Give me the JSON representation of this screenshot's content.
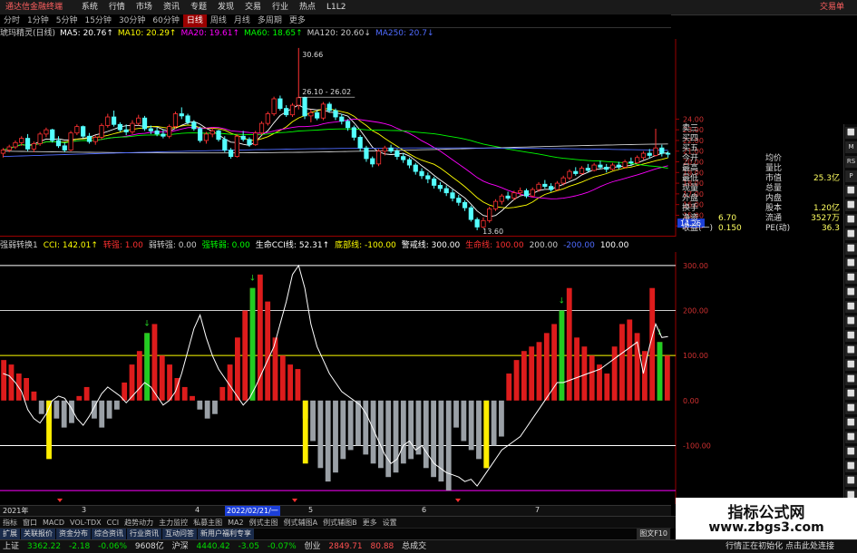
{
  "app": {
    "title": "通达信金融终端",
    "right_label": "交易单"
  },
  "menubar": {
    "items": [
      "系统",
      "行情",
      "市场",
      "资讯",
      "专题",
      "发现",
      "交易",
      "行业",
      "热点",
      "L1L2"
    ]
  },
  "periods": {
    "items": [
      "分时",
      "1分钟",
      "5分钟",
      "15分钟",
      "30分钟",
      "60分钟",
      "日线",
      "周线",
      "月线",
      "多周期",
      "更多"
    ],
    "active": "日线"
  },
  "ma_legend": [
    {
      "label": "琥玛精灵(日线)",
      "color": "#cccccc"
    },
    {
      "label": "MA5: 20.76↑",
      "color": "#ffffff"
    },
    {
      "label": "MA10: 20.29↑",
      "color": "#ffff00"
    },
    {
      "label": "MA20: 19.61↑",
      "color": "#ff00ff"
    },
    {
      "label": "MA60: 18.65↑",
      "color": "#00ff00"
    },
    {
      "label": "MA120: 20.60↓",
      "color": "#cccccc"
    },
    {
      "label": "MA250: 20.7↓",
      "color": "#4f6bff"
    }
  ],
  "indicator_legend": [
    {
      "label": "强弱转换1",
      "color": "#cccccc"
    },
    {
      "label": "CCI: 142.01↑",
      "color": "#ffff00"
    },
    {
      "label": "转强: 1.00",
      "color": "#ff3030"
    },
    {
      "label": "弱转强: 0.00",
      "color": "#cccccc"
    },
    {
      "label": "强转弱: 0.00",
      "color": "#00ff00"
    },
    {
      "label": "生命CCI线: 52.31↑",
      "color": "#ffffff"
    },
    {
      "label": "底部线: -100.00",
      "color": "#ffff00"
    },
    {
      "label": "警戒线: 300.00",
      "color": "#ffffff"
    },
    {
      "label": "生命线: 100.00",
      "color": "#ff3030"
    },
    {
      "label": "200.00",
      "color": "#cccccc"
    },
    {
      "label": "-200.00",
      "color": "#4f6bff"
    },
    {
      "label": "100.00",
      "color": "#ffffff"
    }
  ],
  "quote_panel": {
    "rows": [
      {
        "left": "卖三",
        "mid": "",
        "right": ""
      },
      {
        "left": "买四",
        "mid": "",
        "right": ""
      },
      {
        "left": "买五",
        "mid": "",
        "right": ""
      },
      {
        "left": "今开",
        "mid": "均价",
        "right": ""
      },
      {
        "left": "最高",
        "mid": "量比",
        "right": ""
      },
      {
        "left": "最低",
        "mid": "市值",
        "right": "25.3亿"
      },
      {
        "left": "现量",
        "mid": "总量",
        "right": ""
      },
      {
        "left": "外盘",
        "mid": "内盘",
        "right": ""
      },
      {
        "left": "换手",
        "mid": "股本",
        "right": "1.20亿"
      },
      {
        "left": "净资",
        "mid": "6.70",
        "right": "3527万",
        "midlabel": "流通"
      },
      {
        "left": "收益(一)",
        "mid": "0.150",
        "right": "36.3",
        "midlabel": "PE(动)"
      }
    ]
  },
  "right_toolbar": {
    "items": [
      "⬜",
      "M",
      "RS",
      "P",
      "⬜",
      "⬜",
      "⬜",
      "⬜",
      "⬜",
      "⬜",
      "⬜",
      "⬜",
      "⬜",
      "⬜",
      "⬜",
      "⬜",
      "⬜",
      "⬜",
      "⬜",
      "⬜",
      "⬜",
      "⬜",
      "⬜",
      "⬜",
      "⬜",
      "⬜",
      "⬜"
    ]
  },
  "date_bar": {
    "start": "2021年",
    "cursor": "2022/02/21/一",
    "marks": [
      "3",
      "4",
      "5",
      "6",
      "7"
    ]
  },
  "tabs": {
    "items": [
      "指标",
      "窗口",
      "MACD",
      "VOL-TDX",
      "CCI",
      "趋势动力",
      "主力监控",
      "私募主图",
      "MA2",
      "例式主图",
      "例式辅图A",
      "例式辅图B",
      "更多",
      "设置"
    ],
    "right": "模板"
  },
  "tabs2": {
    "items": [
      "扩展",
      "关联报价",
      "资金分布",
      "综合资讯",
      "行业资讯",
      "互动问答",
      "新用户福利专享"
    ],
    "right": "图文F10"
  },
  "status": {
    "sh_label": "上证",
    "sh_value": "3362.22",
    "sh_change": "-2.18",
    "sh_pct": "-0.06%",
    "sh_amount": "9608亿",
    "sz_label": "沪深",
    "sz_value": "4440.42",
    "sz_change": "-3.05",
    "sz_pct": "-0.07%",
    "cy_label": "创业",
    "cy_value": "2849.71",
    "cy_change": "80.88",
    "other": "总成交",
    "msg": "行情正在初始化 点击此处连接"
  },
  "watermark": {
    "title": "指标公式网",
    "url": "www.zbgs3.com"
  },
  "chart_data": [
    {
      "type": "candlestick",
      "title": "",
      "xlabel": "",
      "ylabel": "",
      "y_ticks": [
        14.0,
        15.0,
        16.0,
        17.0,
        18.0,
        19.0,
        20.0,
        21.0,
        22.0,
        23.0,
        24.0
      ],
      "ylim": [
        13.0,
        31.5
      ],
      "current_price_label": "14.26",
      "annotations": [
        {
          "text": "30.66",
          "kind": "high"
        },
        {
          "text": "26.10 - 26.02",
          "kind": "range"
        },
        {
          "text": "13.60",
          "kind": "low"
        }
      ],
      "grid": false,
      "candles": [
        [
          20.8,
          21.3,
          20.4,
          21.1
        ],
        [
          21.1,
          21.6,
          20.9,
          21.4
        ],
        [
          21.4,
          22.0,
          21.2,
          21.8
        ],
        [
          21.8,
          22.4,
          21.5,
          22.2
        ],
        [
          22.2,
          22.6,
          21.0,
          21.2
        ],
        [
          21.2,
          21.9,
          20.9,
          21.7
        ],
        [
          21.7,
          22.8,
          21.5,
          22.6
        ],
        [
          22.6,
          23.2,
          22.3,
          23.0
        ],
        [
          23.0,
          23.1,
          21.8,
          22.0
        ],
        [
          22.0,
          22.4,
          21.3,
          21.5
        ],
        [
          21.5,
          21.8,
          20.9,
          21.1
        ],
        [
          21.1,
          22.9,
          21.0,
          22.7
        ],
        [
          22.7,
          23.5,
          22.5,
          23.3
        ],
        [
          23.3,
          23.4,
          22.2,
          22.4
        ],
        [
          22.4,
          22.7,
          21.7,
          21.9
        ],
        [
          21.9,
          22.5,
          21.6,
          22.3
        ],
        [
          22.3,
          23.6,
          22.1,
          23.4
        ],
        [
          23.4,
          24.5,
          23.2,
          24.2
        ],
        [
          24.2,
          24.8,
          23.3,
          23.5
        ],
        [
          23.5,
          23.7,
          22.8,
          23.0
        ],
        [
          23.0,
          23.5,
          22.5,
          22.8
        ],
        [
          22.8,
          23.9,
          22.6,
          23.6
        ],
        [
          23.6,
          24.4,
          23.4,
          24.1
        ],
        [
          24.1,
          24.3,
          22.9,
          23.1
        ],
        [
          23.1,
          23.4,
          22.6,
          22.9
        ],
        [
          22.9,
          23.2,
          22.4,
          22.6
        ],
        [
          22.6,
          23.0,
          22.2,
          22.4
        ],
        [
          22.4,
          23.5,
          22.2,
          23.3
        ],
        [
          23.3,
          24.7,
          23.1,
          24.5
        ],
        [
          24.5,
          25.1,
          24.0,
          24.3
        ],
        [
          24.3,
          24.5,
          23.5,
          23.7
        ],
        [
          23.7,
          23.9,
          22.9,
          23.1
        ],
        [
          23.1,
          23.3,
          21.8,
          22.0
        ],
        [
          22.0,
          22.8,
          21.7,
          22.6
        ],
        [
          22.6,
          23.2,
          22.3,
          22.9
        ],
        [
          22.9,
          23.0,
          21.9,
          22.1
        ],
        [
          22.1,
          22.4,
          20.9,
          21.1
        ],
        [
          21.1,
          21.3,
          20.3,
          20.5
        ],
        [
          20.5,
          22.6,
          20.4,
          22.4
        ],
        [
          22.4,
          22.9,
          21.9,
          22.1
        ],
        [
          22.1,
          22.3,
          21.4,
          21.6
        ],
        [
          21.6,
          22.9,
          21.5,
          22.7
        ],
        [
          22.7,
          23.8,
          22.5,
          23.6
        ],
        [
          23.6,
          24.7,
          23.4,
          24.5
        ],
        [
          24.5,
          26.1,
          24.3,
          25.9
        ],
        [
          25.9,
          26.2,
          24.8,
          25.0
        ],
        [
          25.0,
          25.3,
          24.2,
          24.4
        ],
        [
          24.4,
          25.5,
          24.2,
          25.3
        ],
        [
          25.3,
          30.66,
          24.9,
          26.0
        ],
        [
          26.0,
          26.1,
          24.0,
          24.3
        ],
        [
          24.3,
          24.9,
          23.7,
          24.6
        ],
        [
          24.6,
          24.8,
          23.9,
          24.1
        ],
        [
          24.1,
          25.6,
          23.9,
          25.4
        ],
        [
          25.4,
          25.6,
          24.6,
          24.8
        ],
        [
          24.8,
          25.0,
          23.9,
          24.2
        ],
        [
          24.2,
          24.5,
          23.5,
          23.8
        ],
        [
          23.8,
          24.0,
          22.9,
          23.2
        ],
        [
          23.2,
          23.4,
          22.0,
          22.3
        ],
        [
          22.3,
          22.5,
          21.0,
          21.3
        ],
        [
          21.3,
          21.5,
          20.0,
          20.3
        ],
        [
          20.3,
          20.5,
          19.5,
          19.8
        ],
        [
          19.8,
          21.2,
          19.6,
          21.0
        ],
        [
          21.0,
          21.5,
          20.6,
          21.3
        ],
        [
          21.3,
          21.6,
          20.8,
          21.0
        ],
        [
          21.0,
          21.2,
          20.2,
          20.5
        ],
        [
          20.5,
          20.8,
          19.9,
          20.2
        ],
        [
          20.2,
          20.4,
          19.4,
          19.7
        ],
        [
          19.7,
          19.9,
          18.8,
          19.1
        ],
        [
          19.1,
          19.4,
          18.4,
          18.7
        ],
        [
          18.7,
          19.0,
          18.0,
          18.4
        ],
        [
          18.4,
          18.6,
          17.5,
          17.8
        ],
        [
          17.8,
          18.1,
          17.2,
          17.5
        ],
        [
          17.5,
          17.8,
          16.8,
          17.1
        ],
        [
          17.1,
          17.4,
          16.3,
          16.6
        ],
        [
          16.6,
          16.9,
          15.9,
          16.2
        ],
        [
          16.2,
          16.4,
          15.4,
          15.7
        ],
        [
          15.7,
          15.9,
          14.4,
          14.6
        ],
        [
          14.6,
          14.8,
          13.6,
          13.9
        ],
        [
          13.9,
          14.8,
          13.8,
          14.5
        ],
        [
          14.5,
          15.8,
          14.3,
          15.6
        ],
        [
          15.6,
          16.5,
          15.4,
          16.3
        ],
        [
          16.3,
          17.0,
          16.0,
          16.8
        ],
        [
          16.8,
          17.2,
          16.4,
          16.6
        ],
        [
          16.6,
          17.3,
          16.4,
          17.1
        ],
        [
          17.1,
          17.6,
          16.8,
          17.3
        ],
        [
          17.3,
          17.5,
          16.6,
          16.8
        ],
        [
          16.8,
          17.6,
          16.7,
          17.4
        ],
        [
          17.4,
          18.1,
          17.2,
          17.9
        ],
        [
          17.9,
          18.3,
          17.5,
          17.7
        ],
        [
          17.7,
          18.0,
          17.2,
          17.4
        ],
        [
          17.4,
          18.2,
          17.3,
          18.0
        ],
        [
          18.0,
          18.7,
          17.8,
          18.5
        ],
        [
          18.5,
          19.3,
          18.3,
          19.1
        ],
        [
          19.1,
          19.5,
          18.7,
          18.9
        ],
        [
          18.9,
          19.6,
          18.8,
          19.4
        ],
        [
          19.4,
          19.8,
          19.0,
          19.2
        ],
        [
          19.2,
          19.9,
          19.1,
          19.7
        ],
        [
          19.7,
          20.1,
          19.3,
          19.5
        ],
        [
          19.5,
          19.8,
          19.0,
          19.3
        ],
        [
          19.3,
          19.9,
          19.2,
          19.7
        ],
        [
          19.7,
          20.0,
          19.3,
          19.5
        ],
        [
          19.5,
          20.2,
          19.4,
          20.0
        ],
        [
          20.0,
          20.4,
          19.6,
          19.9
        ],
        [
          19.9,
          20.6,
          19.8,
          20.4
        ],
        [
          20.4,
          21.0,
          20.2,
          20.8
        ],
        [
          20.8,
          21.2,
          20.3,
          20.6
        ],
        [
          20.6,
          23.1,
          20.5,
          21.3
        ],
        [
          21.3,
          21.6,
          20.5,
          20.8
        ],
        [
          20.8,
          21.0,
          20.4,
          20.76
        ]
      ],
      "series": [
        {
          "name": "MA5",
          "color": "#ffffff"
        },
        {
          "name": "MA10",
          "color": "#ffff00"
        },
        {
          "name": "MA20",
          "color": "#ff00ff"
        },
        {
          "name": "MA60",
          "color": "#00ff00"
        },
        {
          "name": "MA120",
          "color": "#cccccc"
        },
        {
          "name": "MA250",
          "color": "#4f6bff"
        }
      ]
    },
    {
      "type": "bar",
      "title": "",
      "xlabel": "",
      "ylabel": "",
      "y_ticks": [
        300,
        200,
        100,
        0,
        -100
      ],
      "ylim": [
        -230,
        330
      ],
      "levels": [
        {
          "value": 300,
          "color": "#ffffff"
        },
        {
          "value": 200,
          "color": "#cccccc"
        },
        {
          "value": 100,
          "color": "#ffff00"
        },
        {
          "value": -100,
          "color": "#ffffff"
        },
        {
          "value": -200,
          "color": "#ff00ff"
        }
      ],
      "cci_values": [
        60,
        55,
        40,
        20,
        -20,
        -40,
        -50,
        -30,
        0,
        10,
        5,
        -15,
        -40,
        -55,
        -35,
        -10,
        15,
        30,
        20,
        10,
        -5,
        10,
        25,
        40,
        30,
        10,
        -10,
        0,
        20,
        60,
        110,
        160,
        190,
        140,
        100,
        70,
        50,
        30,
        10,
        -10,
        5,
        30,
        60,
        90,
        120,
        170,
        220,
        280,
        300,
        250,
        170,
        120,
        90,
        60,
        40,
        20,
        10,
        0,
        -10,
        -30,
        -60,
        -90,
        -120,
        -140,
        -130,
        -100,
        -90,
        -110,
        -100,
        -120,
        -140,
        -150,
        -160,
        -165,
        -170,
        -180,
        -175,
        -190,
        -170,
        -150,
        -130,
        -110,
        -100,
        -90,
        -80,
        -60,
        -40,
        -20,
        0,
        20,
        40,
        40,
        45,
        50,
        55,
        60,
        65,
        70,
        80,
        90,
        100,
        110,
        120,
        130,
        60,
        120,
        170,
        140,
        142
      ],
      "bar_values": [
        90,
        80,
        60,
        50,
        20,
        -30,
        -50,
        -40,
        -60,
        -50,
        10,
        30,
        -40,
        -60,
        -40,
        -20,
        40,
        80,
        110,
        150,
        170,
        100,
        80,
        50,
        30,
        10,
        -20,
        -40,
        -30,
        30,
        80,
        140,
        200,
        250,
        280,
        220,
        140,
        100,
        80,
        70,
        -40,
        -90,
        -150,
        -180,
        -160,
        -130,
        -110,
        -100,
        -120,
        -140,
        -150,
        -170,
        -160,
        -140,
        -130,
        -120,
        -150,
        -170,
        -180,
        -200,
        -60,
        -90,
        -110,
        -130,
        -150,
        -100,
        -80,
        60,
        90,
        110,
        120,
        130,
        150,
        170,
        200,
        250,
        140,
        120,
        100,
        80,
        60,
        120,
        170,
        180,
        150,
        110,
        250,
        130,
        100
      ],
      "signal_up_markers": [
        "强转弱"
      ],
      "signal_down_markers": [
        "弱转强"
      ]
    }
  ]
}
